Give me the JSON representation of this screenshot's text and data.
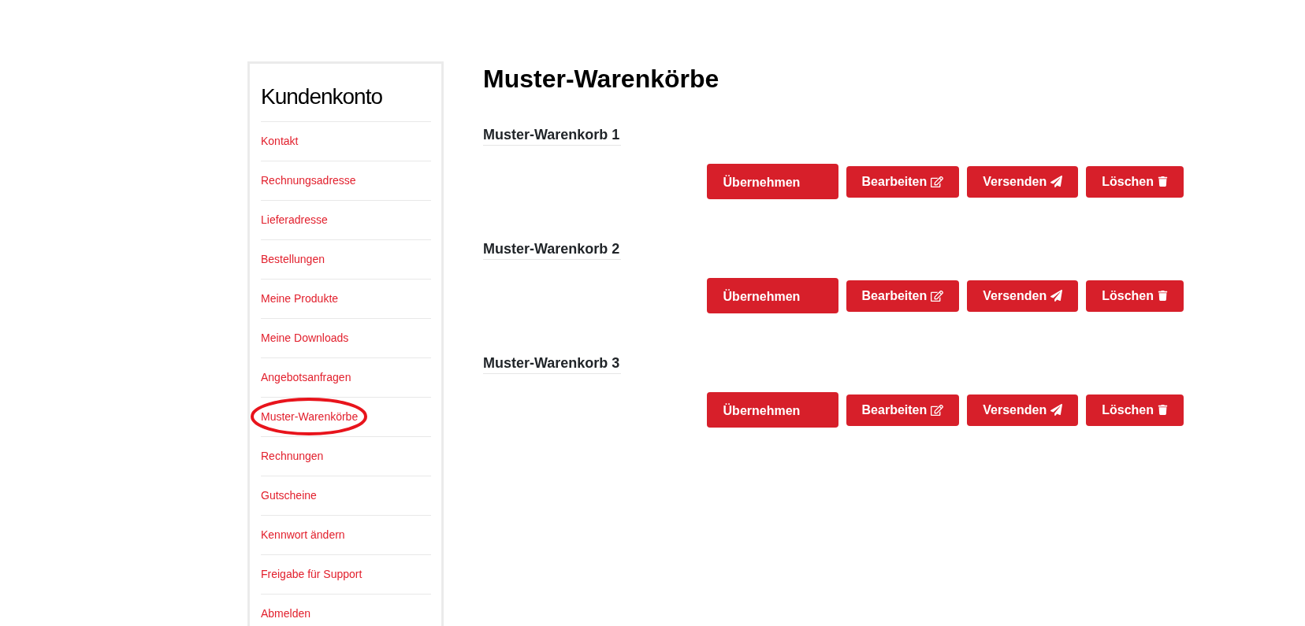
{
  "sidebar": {
    "title": "Kundenkonto",
    "items": [
      {
        "label": "Kontakt",
        "selected": false
      },
      {
        "label": "Rechnungsadresse",
        "selected": false
      },
      {
        "label": "Lieferadresse",
        "selected": false
      },
      {
        "label": "Bestellungen",
        "selected": false
      },
      {
        "label": "Meine Produkte",
        "selected": false
      },
      {
        "label": "Meine Downloads",
        "selected": false
      },
      {
        "label": "Angebotsanfragen",
        "selected": false
      },
      {
        "label": "Muster-Warenkörbe",
        "selected": true
      },
      {
        "label": "Rechnungen",
        "selected": false
      },
      {
        "label": "Gutscheine",
        "selected": false
      },
      {
        "label": "Kennwort ändern",
        "selected": false
      },
      {
        "label": "Freigabe für Support",
        "selected": false
      },
      {
        "label": "Abmelden",
        "selected": false
      }
    ]
  },
  "main": {
    "heading": "Muster-Warenkörbe",
    "carts": [
      {
        "title": "Muster-Warenkorb 1",
        "buttons": [
          {
            "kind": "apply",
            "label": "Übernehmen"
          },
          {
            "kind": "edit",
            "label": "Bearbeiten"
          },
          {
            "kind": "send",
            "label": "Versenden"
          },
          {
            "kind": "delete",
            "label": "Löschen"
          }
        ]
      },
      {
        "title": "Muster-Warenkorb 2",
        "buttons": [
          {
            "kind": "apply",
            "label": "Übernehmen"
          },
          {
            "kind": "edit",
            "label": "Bearbeiten"
          },
          {
            "kind": "send",
            "label": "Versenden"
          },
          {
            "kind": "delete",
            "label": "Löschen"
          }
        ]
      },
      {
        "title": "Muster-Warenkorb 3",
        "buttons": [
          {
            "kind": "apply",
            "label": "Übernehmen"
          },
          {
            "kind": "edit",
            "label": "Bearbeiten"
          },
          {
            "kind": "send",
            "label": "Versenden"
          },
          {
            "kind": "delete",
            "label": "Löschen"
          }
        ]
      }
    ]
  }
}
